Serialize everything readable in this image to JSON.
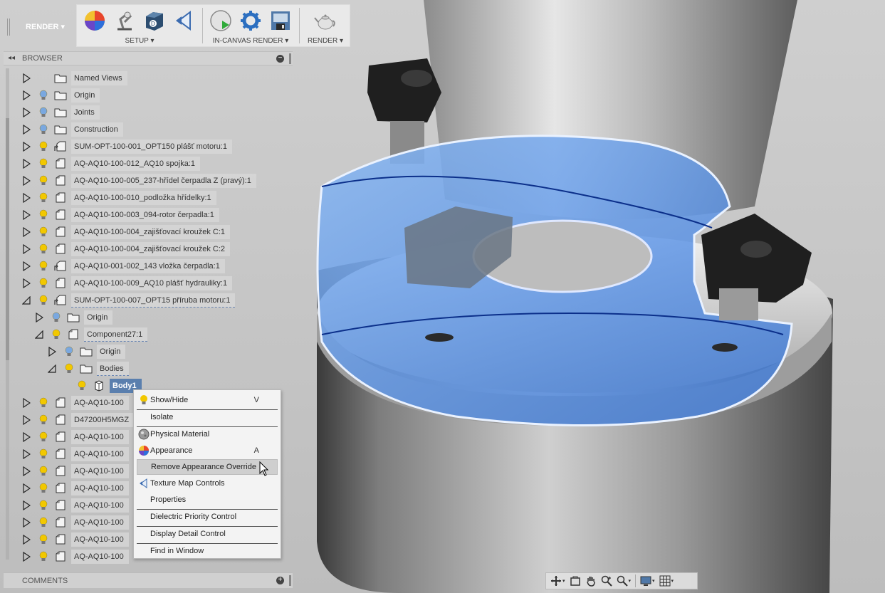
{
  "toolbar": {
    "mode": "RENDER",
    "groups": [
      {
        "label": "SETUP",
        "icons": [
          "appearance-icon",
          "scene-settings-icon",
          "decal-icon",
          "texture-map-icon"
        ]
      },
      {
        "label": "IN-CANVAS RENDER",
        "icons": [
          "in-canvas-render-icon",
          "render-settings-icon",
          "capture-image-icon"
        ]
      },
      {
        "label": "RENDER",
        "icons": [
          "teapot-render-icon"
        ]
      }
    ]
  },
  "browser": {
    "title": "BROWSER",
    "nodes": [
      {
        "label": "Named Views",
        "expand": "collapsed",
        "bulb": "none",
        "icon": "folder",
        "level": 0
      },
      {
        "label": "Origin",
        "expand": "collapsed",
        "bulb": "off",
        "icon": "folder",
        "level": 0
      },
      {
        "label": "Joints",
        "expand": "collapsed",
        "bulb": "off",
        "icon": "folder",
        "level": 0
      },
      {
        "label": "Construction",
        "expand": "collapsed",
        "bulb": "off",
        "icon": "folder",
        "level": 0
      },
      {
        "label": "SUM-OPT-100-001_OPT150 plášť motoru:1",
        "expand": "collapsed",
        "bulb": "on",
        "icon": "component-linked",
        "level": 0
      },
      {
        "label": "AQ-AQ10-100-012_AQ10 spojka:1",
        "expand": "collapsed",
        "bulb": "on",
        "icon": "component",
        "level": 0
      },
      {
        "label": "AQ-AQ10-100-005_237-hřídel čerpadla Z (pravý):1",
        "expand": "collapsed",
        "bulb": "on",
        "icon": "component",
        "level": 0
      },
      {
        "label": "AQ-AQ10-100-010_podložka hřídelky:1",
        "expand": "collapsed",
        "bulb": "on",
        "icon": "component",
        "level": 0
      },
      {
        "label": "AQ-AQ10-100-003_094-rotor čerpadla:1",
        "expand": "collapsed",
        "bulb": "on",
        "icon": "component",
        "level": 0
      },
      {
        "label": "AQ-AQ10-100-004_zajišťovací kroužek C:1",
        "expand": "collapsed",
        "bulb": "on",
        "icon": "component",
        "level": 0
      },
      {
        "label": "AQ-AQ10-100-004_zajišťovací kroužek C:2",
        "expand": "collapsed",
        "bulb": "on",
        "icon": "component",
        "level": 0
      },
      {
        "label": "AQ-AQ10-001-002_143 vložka čerpadla:1",
        "expand": "collapsed",
        "bulb": "on",
        "icon": "component-linked",
        "level": 0
      },
      {
        "label": "AQ-AQ10-100-009_AQ10 plášť hydrauliky:1",
        "expand": "collapsed",
        "bulb": "on",
        "icon": "component",
        "level": 0
      },
      {
        "label": "SUM-OPT-100-007_OPT15 příruba motoru:1",
        "expand": "expanded",
        "bulb": "on",
        "icon": "component-linked",
        "level": 0,
        "dashed": true
      },
      {
        "label": "Origin",
        "expand": "collapsed",
        "bulb": "off",
        "icon": "folder",
        "level": 1
      },
      {
        "label": "Component27:1",
        "expand": "expanded",
        "bulb": "on",
        "icon": "component",
        "level": 1,
        "dashed": true
      },
      {
        "label": "Origin",
        "expand": "collapsed",
        "bulb": "off",
        "icon": "folder",
        "level": 2
      },
      {
        "label": "Bodies",
        "expand": "expanded",
        "bulb": "on",
        "icon": "folder",
        "level": 2,
        "dashed": true
      },
      {
        "label": "Body1",
        "expand": "none",
        "bulb": "on",
        "icon": "body",
        "level": 3,
        "selected": true
      },
      {
        "label": "AQ-AQ10-100",
        "expand": "collapsed",
        "bulb": "on",
        "icon": "component",
        "level": 0
      },
      {
        "label": "D47200H5MGZ",
        "expand": "collapsed",
        "bulb": "on",
        "icon": "component",
        "level": 0
      },
      {
        "label": "AQ-AQ10-100",
        "expand": "collapsed",
        "bulb": "on",
        "icon": "component",
        "level": 0
      },
      {
        "label": "AQ-AQ10-100",
        "expand": "collapsed",
        "bulb": "on",
        "icon": "component",
        "level": 0
      },
      {
        "label": "AQ-AQ10-100",
        "expand": "collapsed",
        "bulb": "on",
        "icon": "component",
        "level": 0
      },
      {
        "label": "AQ-AQ10-100",
        "expand": "collapsed",
        "bulb": "on",
        "icon": "component",
        "level": 0
      },
      {
        "label": "AQ-AQ10-100",
        "expand": "collapsed",
        "bulb": "on",
        "icon": "component",
        "level": 0
      },
      {
        "label": "AQ-AQ10-100",
        "expand": "collapsed",
        "bulb": "on",
        "icon": "component",
        "level": 0
      },
      {
        "label": "AQ-AQ10-100",
        "expand": "collapsed",
        "bulb": "on",
        "icon": "component",
        "level": 0
      },
      {
        "label": "AQ-AQ10-100",
        "expand": "collapsed",
        "bulb": "on",
        "icon": "component",
        "level": 0
      }
    ]
  },
  "context_menu": {
    "items": [
      {
        "label": "Show/Hide",
        "shortcut": "V",
        "icon": "lightbulb-icon"
      },
      {
        "separator": true
      },
      {
        "label": "Isolate",
        "shortcut": "",
        "icon": ""
      },
      {
        "separator": true
      },
      {
        "label": "Physical Material",
        "shortcut": "",
        "icon": "physical-material-icon"
      },
      {
        "label": "Appearance",
        "shortcut": "A",
        "icon": "appearance-icon"
      },
      {
        "label": "Remove Appearance Override",
        "shortcut": "",
        "icon": "",
        "hover": true
      },
      {
        "label": "Texture Map Controls",
        "shortcut": "",
        "icon": "texture-map-icon"
      },
      {
        "label": "Properties",
        "shortcut": "",
        "icon": ""
      },
      {
        "separator": true
      },
      {
        "label": "Dielectric Priority Control",
        "shortcut": "",
        "icon": ""
      },
      {
        "separator": true
      },
      {
        "label": "Display Detail Control",
        "shortcut": "",
        "icon": ""
      },
      {
        "separator": true
      },
      {
        "label": "Find in Window",
        "shortcut": "",
        "icon": ""
      }
    ]
  },
  "comments": {
    "title": "COMMENTS"
  },
  "navbar": {
    "tools": [
      "orbit-icon",
      "look-at-icon",
      "pan-icon",
      "zoom-icon",
      "zoom-window-icon",
      "display-settings-icon",
      "grid-icon"
    ]
  },
  "colors": {
    "selection": "#5a7fae",
    "highlight_blue": "#5c95e8",
    "bulb_on": "#f2c800",
    "bulb_off": "#7aa8e0"
  }
}
